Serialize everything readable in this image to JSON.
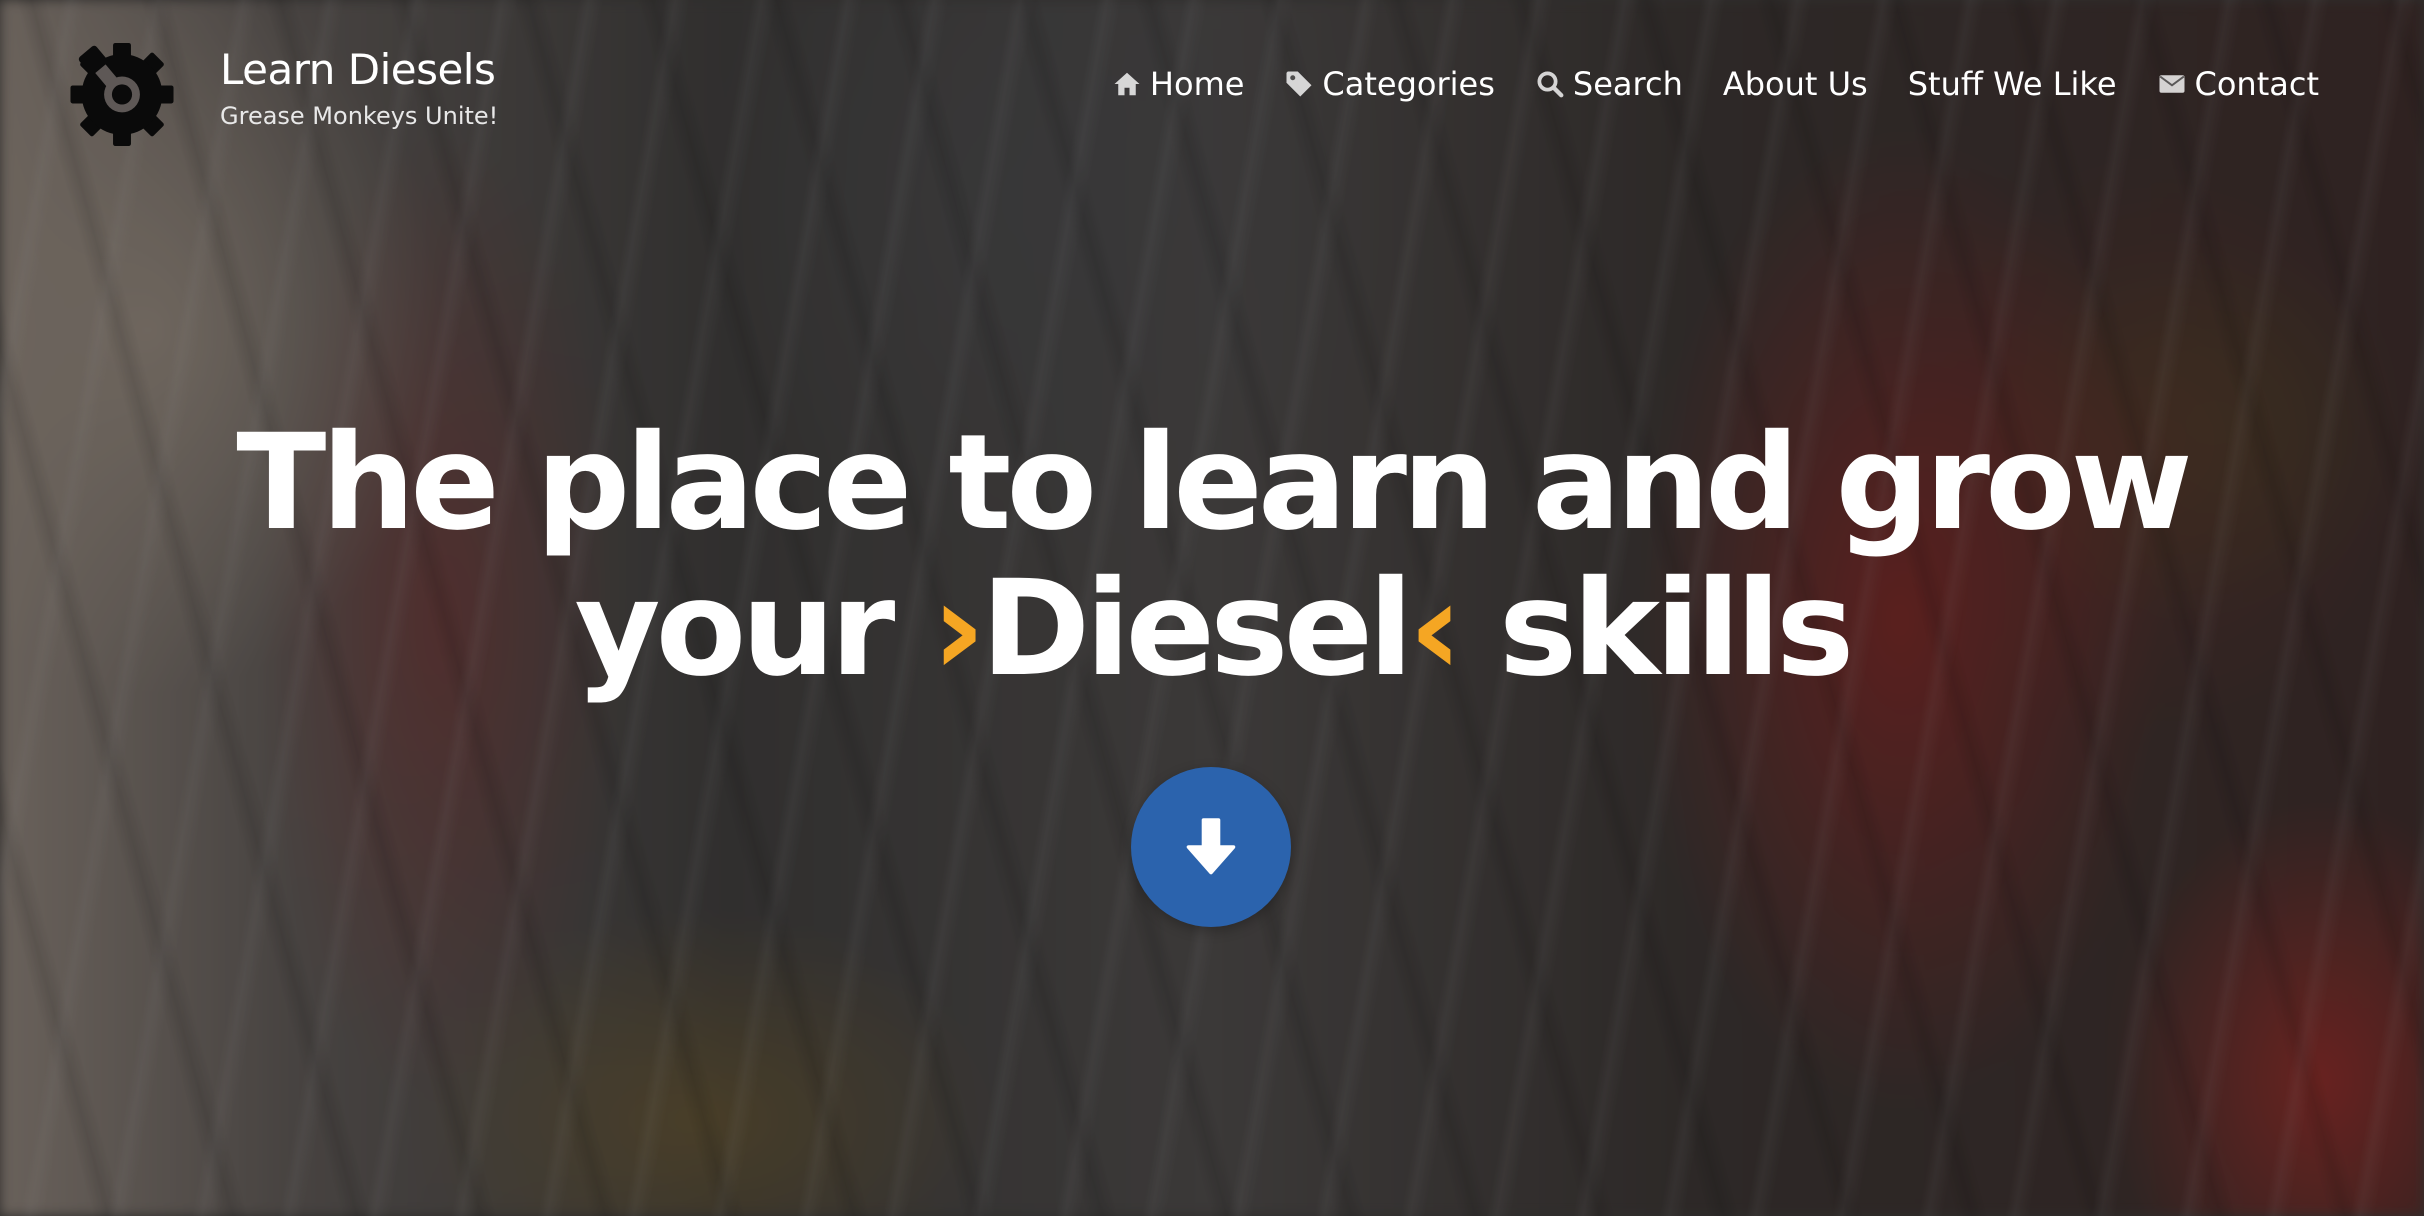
{
  "site": {
    "title": "Learn Diesels",
    "tagline": "Grease Monkeys Unite!",
    "logo_icon": "gear-wrench-icon"
  },
  "nav": {
    "items": [
      {
        "label": "Home",
        "icon": "home-icon"
      },
      {
        "label": "Categories",
        "icon": "tag-icon"
      },
      {
        "label": "Search",
        "icon": "search-icon"
      },
      {
        "label": "About Us",
        "icon": ""
      },
      {
        "label": "Stuff We Like",
        "icon": ""
      },
      {
        "label": "Contact",
        "icon": "envelope-icon"
      }
    ]
  },
  "hero": {
    "line1": "The place to learn and grow",
    "line2_prefix": "your ",
    "accent_open": "›",
    "highlight": "Diesel",
    "accent_close": "‹",
    "line2_suffix": " skills",
    "scroll_icon": "arrow-down-icon"
  },
  "colors": {
    "accent": "#f5a623",
    "button": "#2b63ad",
    "text": "#ffffff"
  }
}
